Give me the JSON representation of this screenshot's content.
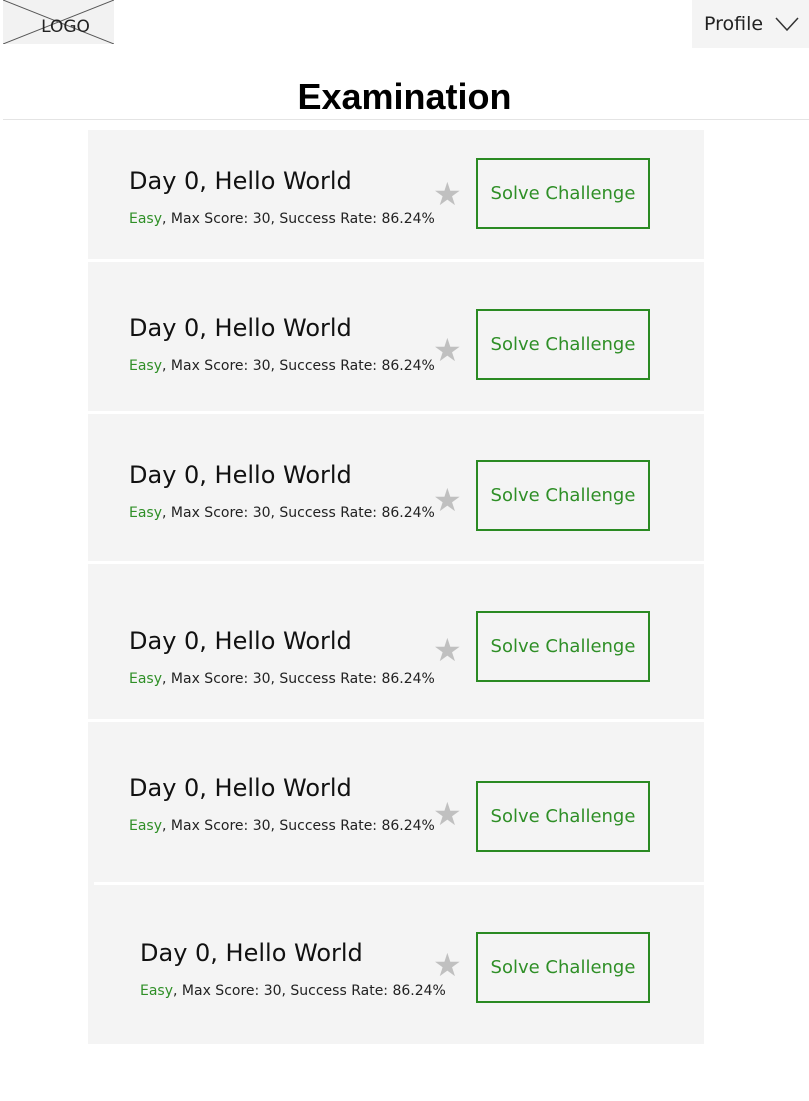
{
  "header": {
    "logo_text": "LOGO",
    "profile_label": "Profile"
  },
  "page": {
    "title": "Examination"
  },
  "challenges": [
    {
      "name": "Day  0, Hello World",
      "difficulty": "Easy",
      "meta": ",  Max Score: 30, Success Rate:  86.24%",
      "button": "Solve Challenge"
    },
    {
      "name": "Day  0, Hello World",
      "difficulty": "Easy",
      "meta": ",  Max Score: 30, Success Rate:  86.24%",
      "button": "Solve Challenge"
    },
    {
      "name": "Day  0, Hello World",
      "difficulty": "Easy",
      "meta": ",  Max Score: 30, Success Rate:  86.24%",
      "button": "Solve Challenge"
    },
    {
      "name": "Day  0, Hello World",
      "difficulty": "Easy",
      "meta": ",  Max Score: 30, Success Rate:  86.24%",
      "button": "Solve Challenge"
    },
    {
      "name": "Day  0, Hello World",
      "difficulty": "Easy",
      "meta": ",  Max Score: 30, Success Rate:  86.24%",
      "button": "Solve Challenge"
    },
    {
      "name": "Day  0, Hello World",
      "difficulty": "Easy",
      "meta": ",  Max Score: 30, Success Rate:  86.24%",
      "button": "Solve Challenge"
    }
  ],
  "icons": {
    "star": "star-icon",
    "profile_chevron": "chevron-down-icon"
  },
  "colors": {
    "accent": "#2f8f27",
    "card_bg": "#f4f4f4",
    "star": "#c0c0c0"
  }
}
